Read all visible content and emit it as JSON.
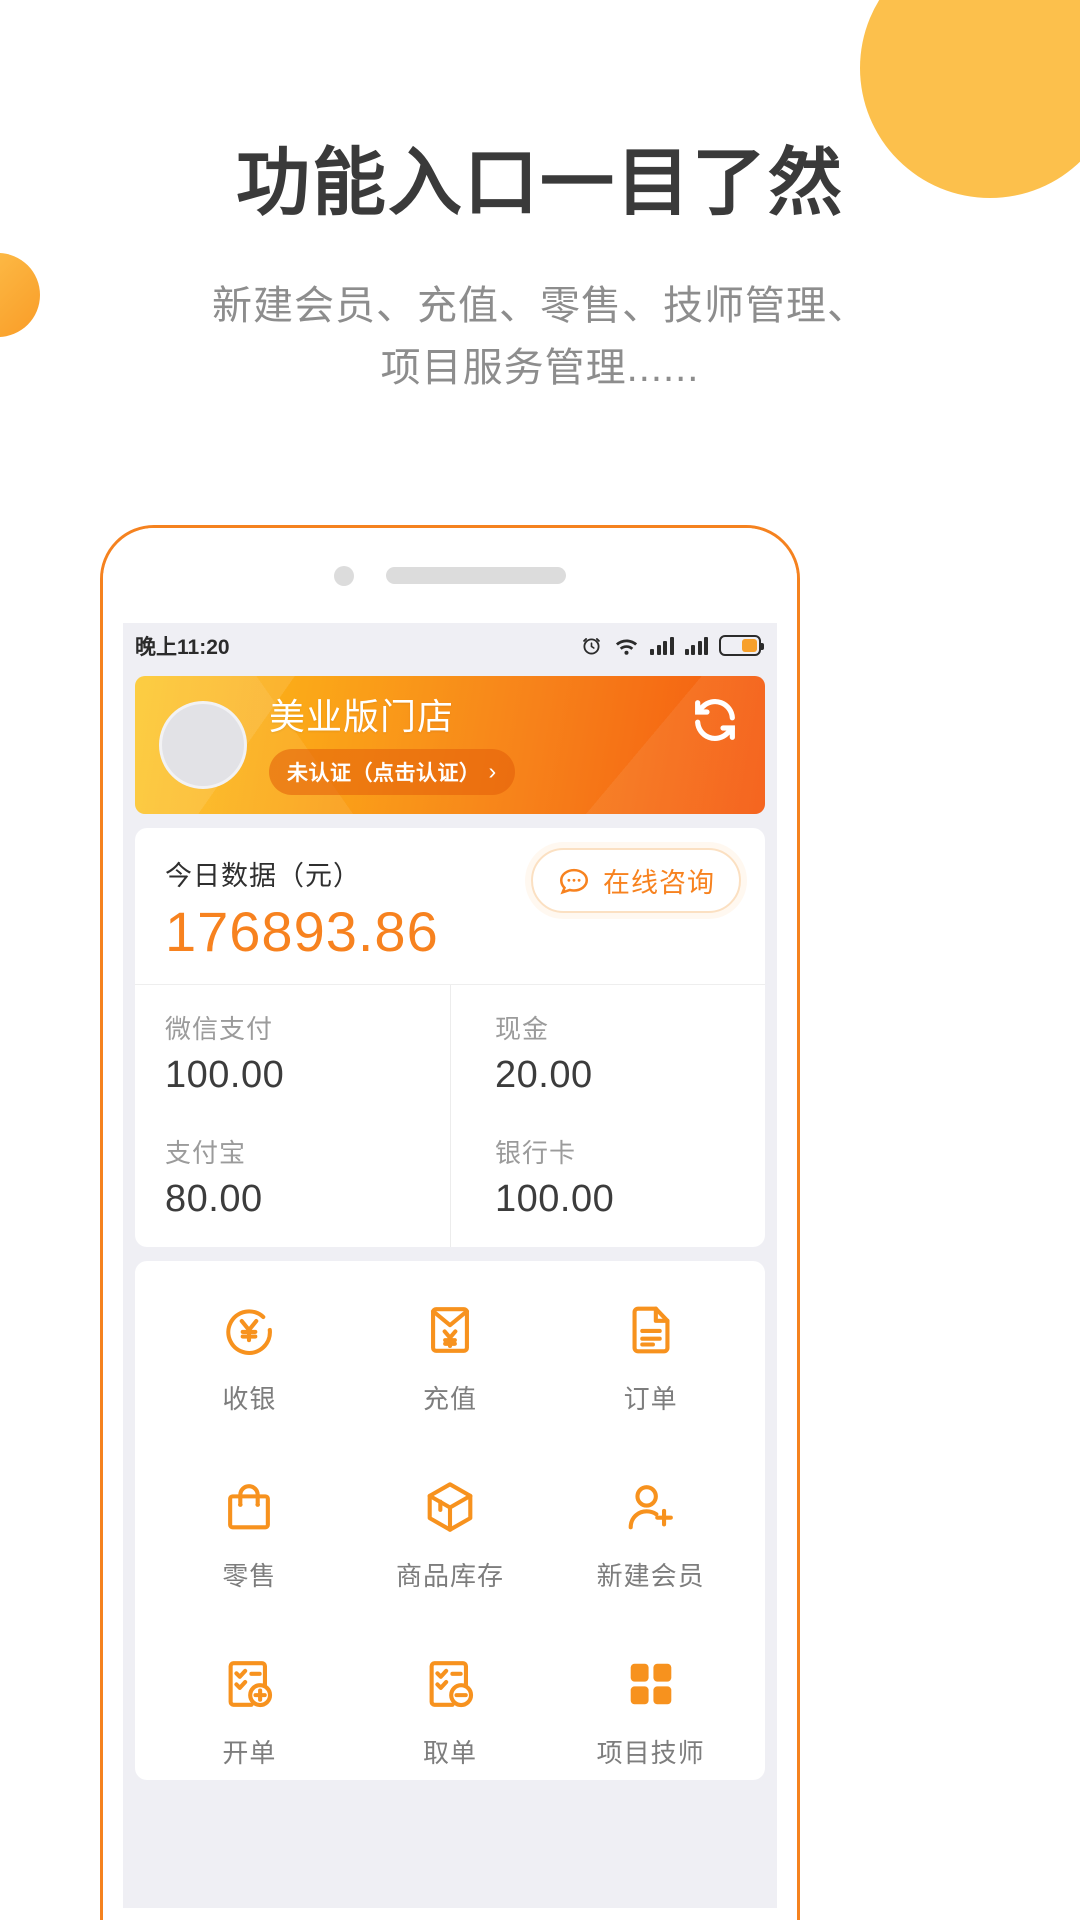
{
  "promo": {
    "headline": "功能入口一目了然",
    "subhead_line1": "新建会员、充值、零售、技师管理、",
    "subhead_line2": "项目服务管理......"
  },
  "colors": {
    "accent": "#f7821f",
    "banner_start": "#fcc31b",
    "banner_end": "#f4590f",
    "heading": "#3a3a3a",
    "subhead": "#8d8d8d",
    "screen_bg": "#efeff4"
  },
  "phone": {
    "statusbar": {
      "time": "晚上11:20",
      "icons": [
        "alarm-icon",
        "wifi-icon",
        "signal-icon",
        "signal-icon",
        "battery-icon"
      ]
    },
    "banner": {
      "avatar": "avatar-placeholder",
      "shop_name": "美业版门店",
      "verify_label": "未认证（点击认证）",
      "verify_chevron": "›",
      "refresh_icon": "refresh-icon"
    },
    "data_card": {
      "today_label": "今日数据（元）",
      "today_amount": "176893.86",
      "consult_label": "在线咨询",
      "consult_icon": "chat-bubble-icon",
      "payments": [
        {
          "name": "微信支付",
          "value": "100.00"
        },
        {
          "name": "现金",
          "value": "20.00"
        },
        {
          "name": "支付宝",
          "value": "80.00"
        },
        {
          "name": "银行卡",
          "value": "100.00"
        }
      ]
    },
    "menu": [
      {
        "label": "收银",
        "icon": "yen-circle-icon"
      },
      {
        "label": "充值",
        "icon": "red-envelope-yen-icon"
      },
      {
        "label": "订单",
        "icon": "document-icon"
      },
      {
        "label": "零售",
        "icon": "shopping-bag-icon"
      },
      {
        "label": "商品库存",
        "icon": "box-icon"
      },
      {
        "label": "新建会员",
        "icon": "user-plus-icon"
      },
      {
        "label": "开单",
        "icon": "checklist-plus-icon"
      },
      {
        "label": "取单",
        "icon": "checklist-minus-icon"
      },
      {
        "label": "项目技师",
        "icon": "grid-squares-icon"
      }
    ]
  }
}
